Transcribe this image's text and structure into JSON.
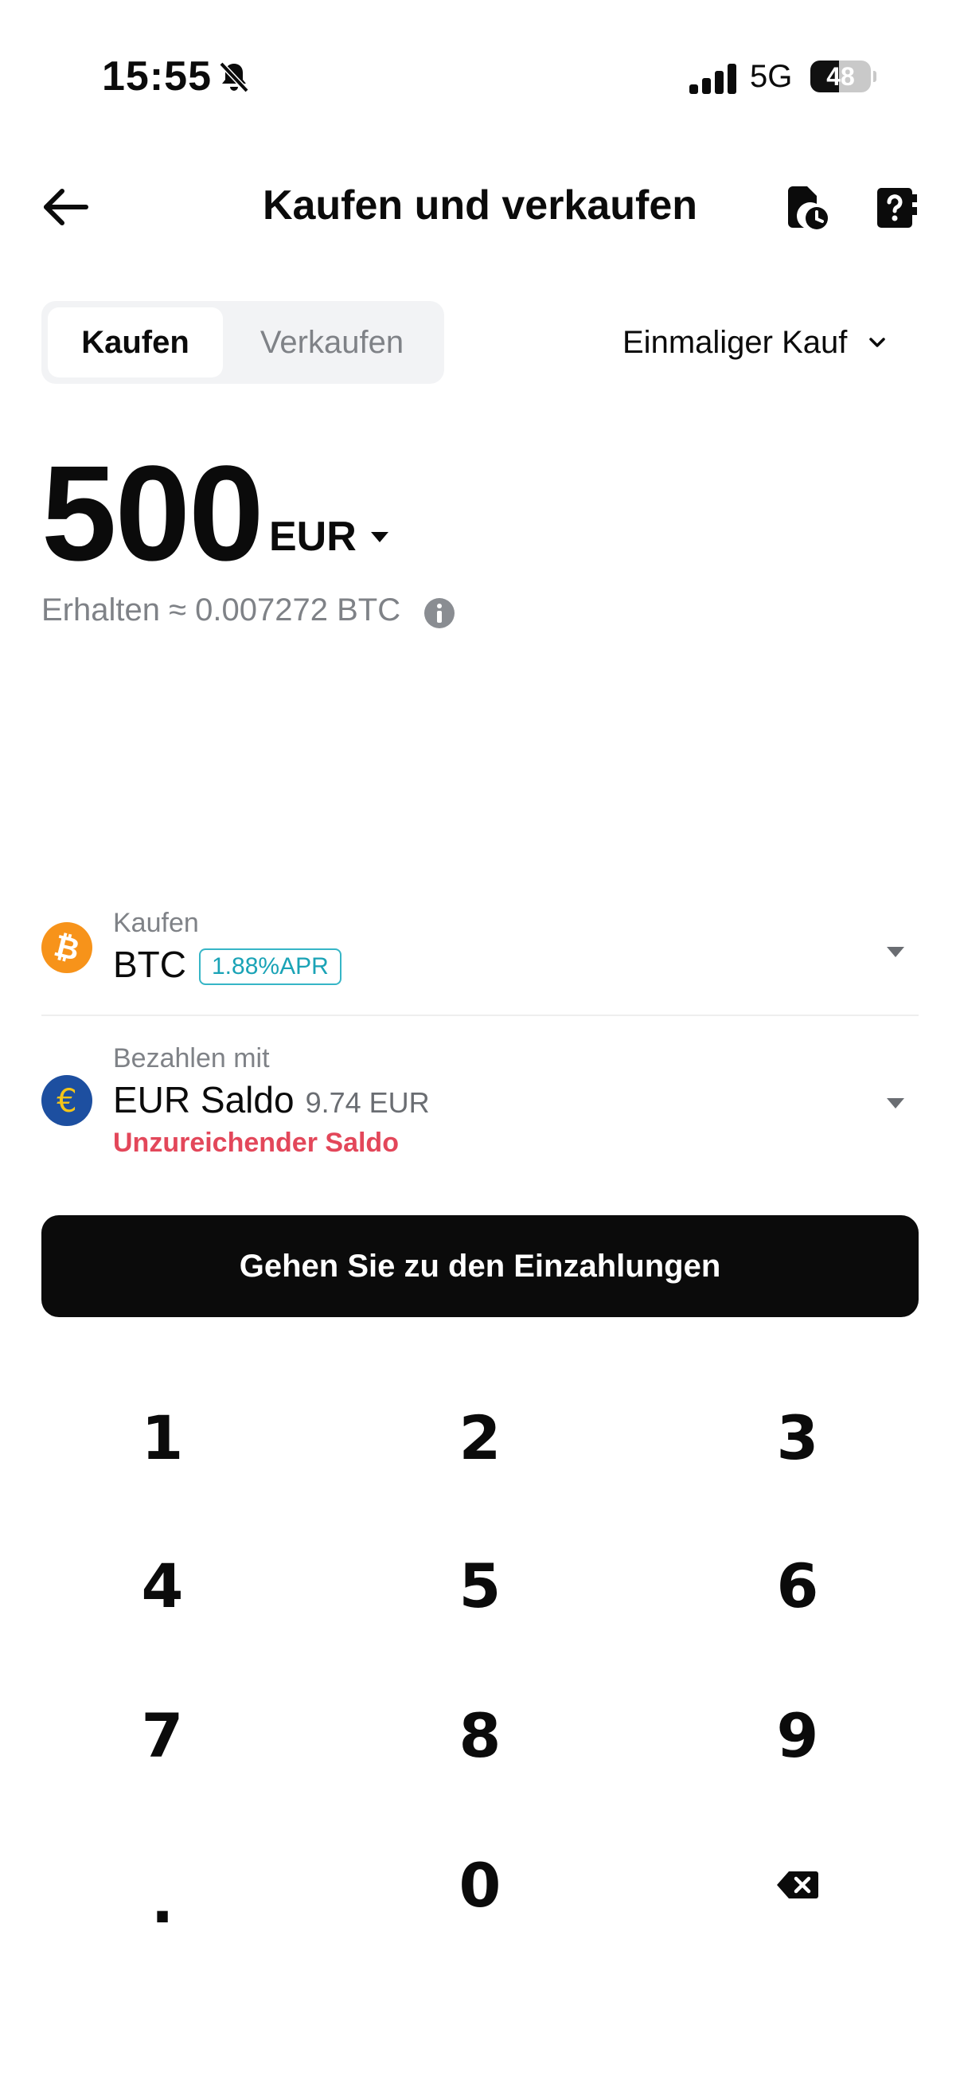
{
  "status": {
    "time": "15:55",
    "network": "5G",
    "battery": "48",
    "battery_level": 0.48
  },
  "header": {
    "title": "Kaufen und verkaufen"
  },
  "tabs": {
    "buy": "Kaufen",
    "sell": "Verkaufen"
  },
  "mode": {
    "label": "Einmaliger Kauf"
  },
  "amount": {
    "value": "500",
    "currency": "EUR"
  },
  "estimate": {
    "text": "Erhalten ≈ 0.007272 BTC"
  },
  "buy_row": {
    "label": "Kaufen",
    "asset": "BTC",
    "badge": "1.88%APR",
    "icon": "bitcoin-icon",
    "icon_color": "#f7931a"
  },
  "pay_row": {
    "label": "Bezahlen mit",
    "method": "EUR Saldo",
    "balance": "9.74 EUR",
    "warning": "Unzureichender Saldo",
    "icon": "euro-icon",
    "icon_color": "#1d4fa0",
    "warning_color": "#e3475a"
  },
  "cta": {
    "label": "Gehen Sie zu den Einzahlungen"
  },
  "keypad": {
    "keys": [
      "1",
      "2",
      "3",
      "4",
      "5",
      "6",
      "7",
      "8",
      "9",
      ".",
      "0"
    ],
    "delete_icon": "backspace-icon"
  }
}
